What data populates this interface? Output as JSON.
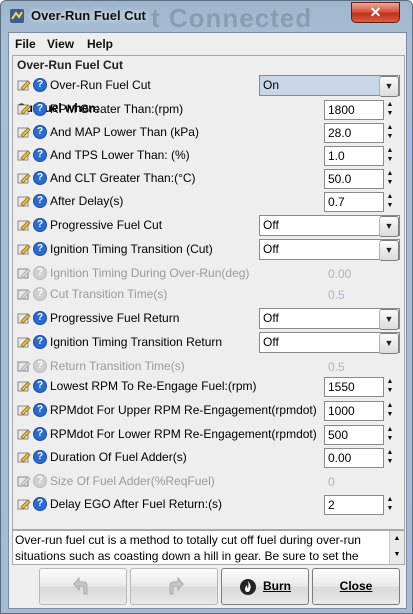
{
  "window": {
    "title": "Over-Run Fuel Cut",
    "ghost_text": "t Connected"
  },
  "menu": [
    "File",
    "View",
    "Help"
  ],
  "panel": {
    "title": "Over-Run Fuel Cut",
    "main_setting": {
      "label": "Over-Run Fuel Cut",
      "value": "On"
    },
    "section_label": "Cut fuel when:",
    "rows": [
      {
        "label": "RPM Greater Than:(rpm)",
        "kind": "spin",
        "value": "1800",
        "enabled": true
      },
      {
        "label": "And MAP Lower Than  (kPa)",
        "kind": "spin",
        "value": "28.0",
        "enabled": true
      },
      {
        "label": "And TPS Lower Than:  (%)",
        "kind": "spin",
        "value": "1.0",
        "enabled": true
      },
      {
        "label": "And CLT Greater Than:(°C)",
        "kind": "spin",
        "value": "50.0",
        "enabled": true
      },
      {
        "label": "After Delay(s)",
        "kind": "spin",
        "value": "0.7",
        "enabled": true
      },
      {
        "label": "Progressive Fuel Cut",
        "kind": "combo",
        "value": "Off",
        "enabled": true
      },
      {
        "label": "Ignition Timing Transition (Cut)",
        "kind": "combo",
        "value": "Off",
        "enabled": true
      },
      {
        "label": "Ignition Timing During Over-Run(deg)",
        "kind": "spin",
        "value": "0.00",
        "enabled": false
      },
      {
        "label": "Cut Transition Time(s)",
        "kind": "spin",
        "value": "0.5",
        "enabled": false
      },
      {
        "label": "Progressive Fuel Return",
        "kind": "combo",
        "value": "Off",
        "enabled": true
      },
      {
        "label": "Ignition Timing Transition Return",
        "kind": "combo",
        "value": "Off",
        "enabled": true
      },
      {
        "label": "Return Transition Time(s)",
        "kind": "spin",
        "value": "0.5",
        "enabled": false
      },
      {
        "label": "Lowest RPM To Re-Engage Fuel:(rpm)",
        "kind": "spin",
        "value": "1550",
        "enabled": true
      },
      {
        "label": "RPMdot For Upper RPM Re-Engagement(rpmdot)",
        "kind": "spin",
        "value": "1000",
        "enabled": true
      },
      {
        "label": "RPMdot For Lower RPM Re-Engagement(rpmdot)",
        "kind": "spin",
        "value": "500",
        "enabled": true
      },
      {
        "label": "Duration Of Fuel Adder(s)",
        "kind": "spin",
        "value": "0.00",
        "enabled": true
      },
      {
        "label": "Size Of Fuel Adder(%ReqFuel)",
        "kind": "spin",
        "value": "0",
        "enabled": false
      },
      {
        "label": "Delay EGO After Fuel Return:(s)",
        "kind": "spin",
        "value": "2",
        "enabled": true
      }
    ]
  },
  "help_text": "Over-run fuel cut is a method to totally cut off fuel during over-run situations such as coasting down a hill in gear. Be sure to set the",
  "buttons": {
    "burn": "Burn",
    "close": "Close"
  },
  "icons": {
    "help": "help-icon",
    "edit": "edit-pencil-icon",
    "undo": "undo-icon",
    "redo": "redo-icon",
    "burn": "burn-icon"
  },
  "colors": {
    "title_bar": "#a7bcd3",
    "help_icon": "#2a6bd1",
    "close_button": "#c2301c",
    "selected_combo": "#c8d6e8"
  }
}
